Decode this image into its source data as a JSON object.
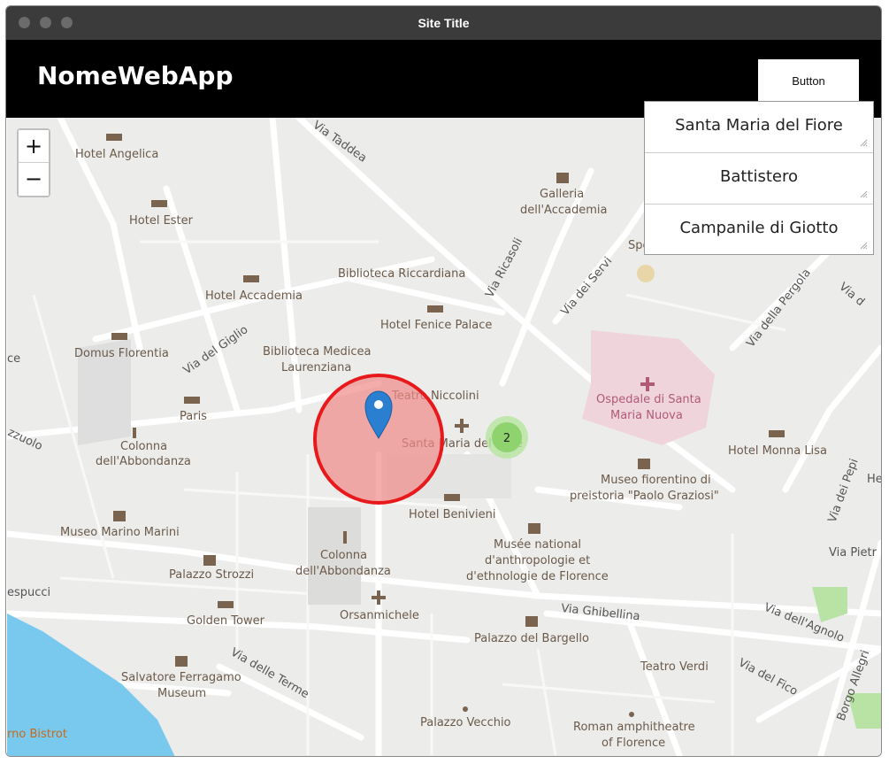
{
  "window": {
    "title": "Site Title"
  },
  "header": {
    "brand": "NomeWebApp",
    "button_label": "Button"
  },
  "map": {
    "zoom_in": "+",
    "zoom_out": "−",
    "cluster_count": "2",
    "places": [
      "Hotel Angelica",
      "Hotel Ester",
      "Galleria",
      "dell'Accademia",
      "Biblioteca Riccardiana",
      "Hotel Accademia",
      "Hotel Fenice Palace",
      "Domus Florentia",
      "Biblioteca Medicea",
      "Laurenziana",
      "Teatro Niccolini",
      "Ospedale di Santa",
      "Maria Nuova",
      "Paris",
      "Colonna",
      "dell'Abbondanza",
      "Santa Maria del Fiore",
      "Hotel Monna Lisa",
      "Museo fiorentino di",
      "preistoria \"Paolo Graziosi\"",
      "Hotel Benivieni",
      "Museo Marino Marini",
      "Musée national",
      "d'anthropologie et",
      "d'ethnologie de Florence",
      "Palazzo Strozzi",
      "Colonna",
      "dell'Abbondanza",
      "Golden Tower",
      "Orsanmichele",
      "Palazzo del Bargello",
      "Teatro Verdi",
      "Salvatore Ferragamo",
      "Museum",
      "Palazzo Vecchio",
      "Roman amphitheatre",
      "of Florence",
      "rno Bistrot",
      "Spe"
    ],
    "streets": [
      "Via Taddea",
      "Via Ricasoli",
      "Via dei Servi",
      "Via della Pergola",
      "Via d",
      "Via del Giglio",
      "Via Ghibellina",
      "Via dell'Agnolo",
      "Via delle Terme",
      "Via del Fico",
      "Borgo Allegri",
      "Via Pietr",
      "Via dei Pepi",
      "espucci",
      "zzuolo",
      "ce",
      "Via",
      "He"
    ]
  },
  "panel": {
    "items": [
      "Santa Maria del Fiore",
      "Battistero",
      "Campanile di Giotto"
    ]
  },
  "colors": {
    "header_bg": "#000000",
    "titlebar_bg": "#3b3b3b",
    "map_bg": "#ececea",
    "river": "#79c9ef",
    "hospital": "#f0d4dc",
    "circle_stroke": "#e8191c",
    "circle_fill": "#f08a87",
    "marker": "#2a7fd1",
    "cluster": "#8fd36e"
  }
}
